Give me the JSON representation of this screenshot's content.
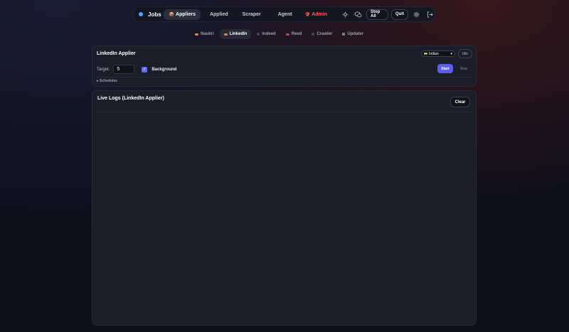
{
  "app": {
    "brand": "Jobs",
    "brand_color": "#4aa3ff",
    "accent": "#5b5ff0",
    "danger": "#ff5a5a"
  },
  "nav": {
    "tabs": [
      {
        "label": "Appliers",
        "icon": "package-emoji",
        "active": true
      },
      {
        "label": "Applied"
      },
      {
        "label": "Scraper"
      },
      {
        "label": "Agent"
      },
      {
        "label": "Admin",
        "icon": "shield-emoji"
      }
    ],
    "icons": [
      "sun-icon",
      "chat-icon"
    ],
    "stop_all": "Stop All",
    "quit": "Quit",
    "settings_icon": "gear-icon",
    "logout_icon": "logout-icon"
  },
  "subtabs": [
    {
      "label": "Naukri"
    },
    {
      "label": "LinkedIn",
      "active": true
    },
    {
      "label": "Indeed"
    },
    {
      "label": "Reed"
    },
    {
      "label": "Crawler"
    },
    {
      "label": "Updater"
    }
  ],
  "applier": {
    "title": "LinkedIn Applier",
    "region": "Indian",
    "status": "Idle",
    "target_label": "Target:",
    "target_value": "5",
    "background_label": "Background",
    "background_checked": true,
    "start": "Start",
    "stop": "Stop",
    "schedules": "Schedules"
  },
  "logs": {
    "title": "Live Logs (LinkedIn Applier)",
    "clear": "Clear"
  }
}
